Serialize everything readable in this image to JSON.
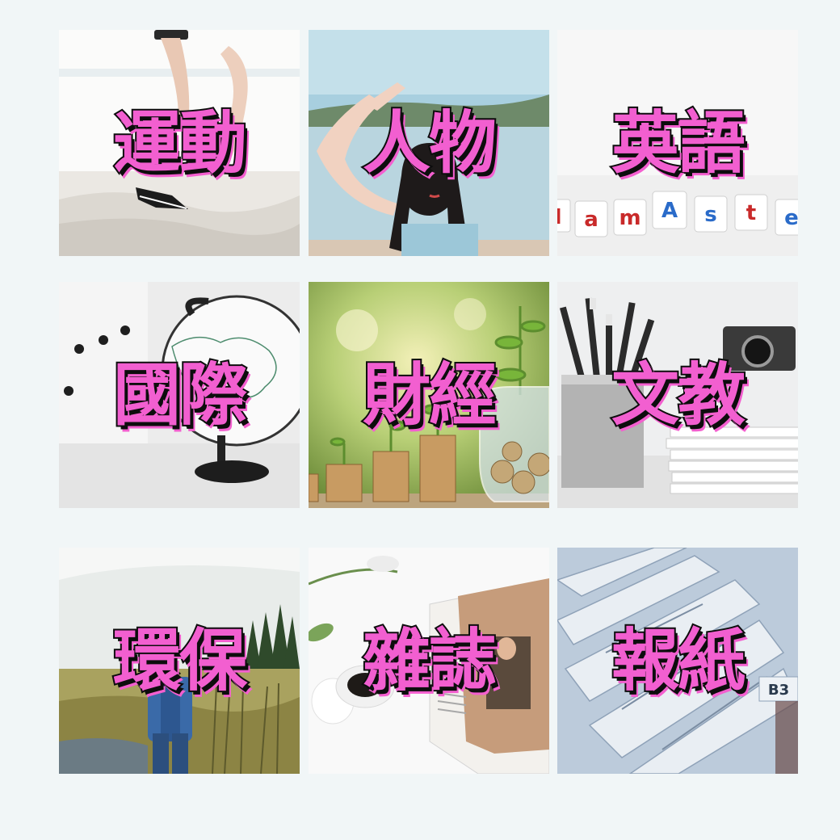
{
  "categories": [
    {
      "label": "運動"
    },
    {
      "label": "人物"
    },
    {
      "label": "英語",
      "tiles_text": [
        "I",
        "a",
        "m",
        "A",
        "s",
        "t",
        "e"
      ]
    },
    {
      "label": "國際"
    },
    {
      "label": "財經"
    },
    {
      "label": "文教"
    },
    {
      "label": "環保"
    },
    {
      "label": "雜誌"
    },
    {
      "label": "報紙",
      "newsprint_text": "B3"
    }
  ],
  "colors": {
    "background": "#f1f6f7",
    "label_fill": "#f25fd0",
    "label_outline": "#0d0d0d"
  }
}
